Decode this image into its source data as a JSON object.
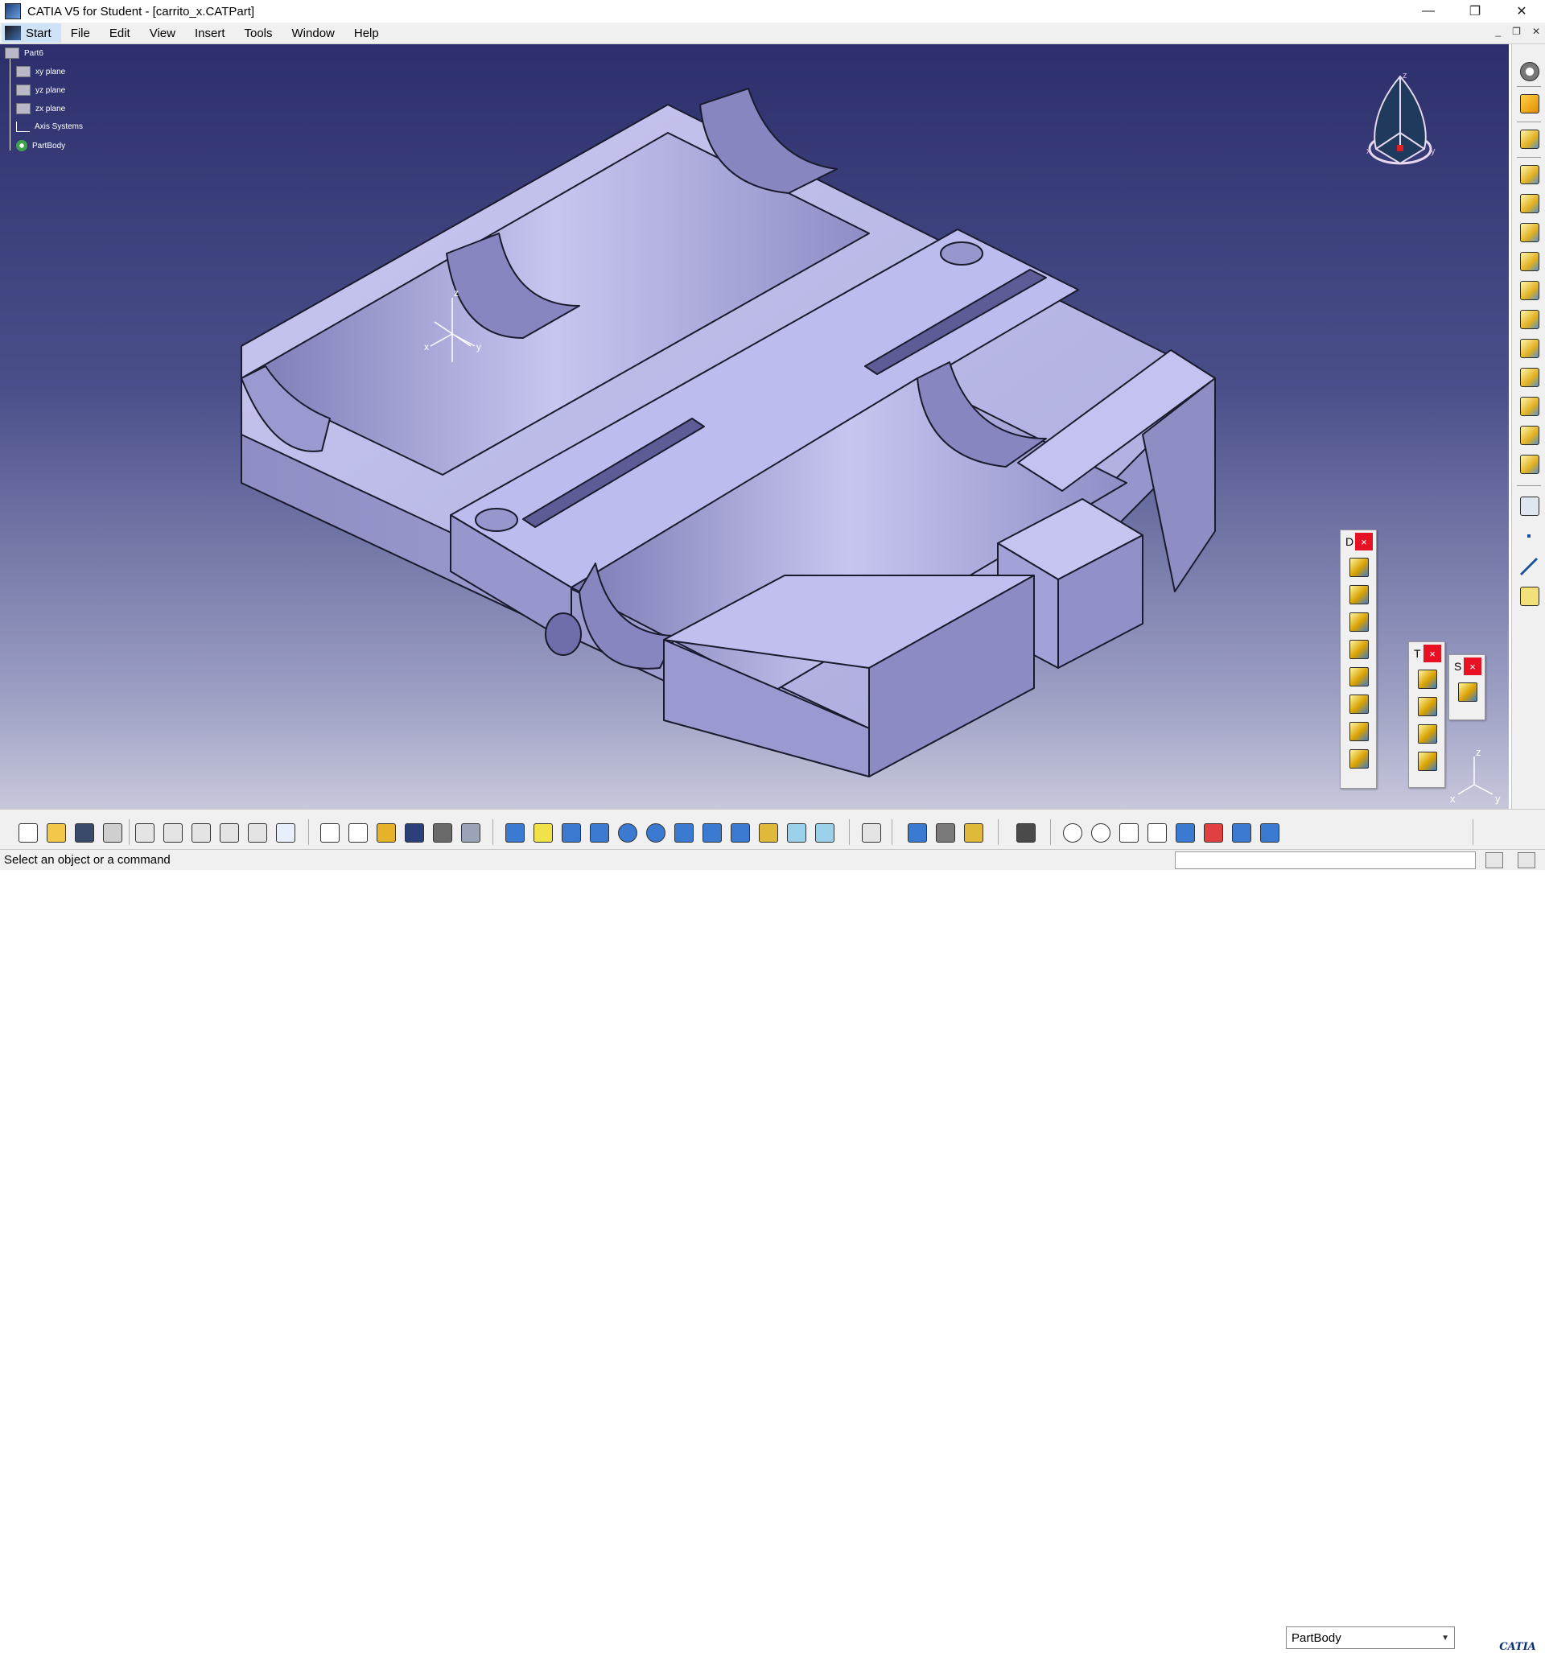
{
  "window": {
    "title": "CATIA V5 for Student - [carrito_x.CATPart]",
    "minimize_glyph": "—",
    "restore_glyph": "❐",
    "close_glyph": "✕"
  },
  "menu": {
    "start": "Start",
    "items": [
      "File",
      "Edit",
      "View",
      "Insert",
      "Tools",
      "Window",
      "Help"
    ],
    "mdi_glyphs": [
      "_",
      "❐",
      "✕"
    ]
  },
  "tree": {
    "root": "Part6",
    "children": [
      "xy plane",
      "yz plane",
      "zx plane",
      "Axis Systems",
      "PartBody"
    ]
  },
  "viewport": {
    "background_top": "#2c2f6b",
    "background_bottom": "#c7c8dc",
    "part_color": "#b7b6e6",
    "compass_labels": {
      "z": "z",
      "x": "x",
      "y": "y"
    },
    "axis_labels": {
      "x": "x",
      "y": "y",
      "z": "z"
    }
  },
  "floating_toolbars": [
    {
      "label": "D",
      "close": "×",
      "buttons": 8
    },
    {
      "label": "T",
      "close": "×",
      "buttons": 4
    },
    {
      "label": "S",
      "close": "×",
      "buttons": 1
    }
  ],
  "right_toolbar": {
    "icons": [
      "options-icon",
      "select-icon",
      "sketcher-icon",
      "pad-icon",
      "pocket-icon",
      "shaft-icon",
      "groove-icon",
      "hole-icon",
      "rib-icon",
      "slot-icon",
      "stiffener-icon",
      "multi-section-solid-icon",
      "removed-multi-section-icon",
      "extract-icon",
      "solid-combine-icon",
      "point-icon",
      "line-icon",
      "plane-icon"
    ]
  },
  "bottom_toolbar": {
    "icons": [
      "new-icon",
      "open-icon",
      "save-icon",
      "print-icon",
      "cut-icon",
      "copy-icon",
      "paste-icon",
      "undo-icon",
      "redo-icon",
      "whats-this-icon",
      "formula-icon",
      "comment-icon",
      "knowledge-icon",
      "table-icon",
      "catalog-icon",
      "measure-icon",
      "fly-icon",
      "fit-all-icon",
      "pan-icon",
      "rotate-icon",
      "zoom-in-icon",
      "zoom-out-icon",
      "normal-view-icon",
      "multi-view-icon",
      "iso-view-icon",
      "shading-icon",
      "hide-show-icon",
      "swap-visible-icon",
      "update-icon",
      "measure-between-icon",
      "measure-item-icon",
      "mass-icon",
      "capture-icon",
      "refresh-icon",
      "wireframe-icon",
      "axis-icon",
      "units-icon",
      "layer-icon",
      "graph-icon",
      "properties-icon",
      "plane-fill-icon"
    ],
    "current_body": "PartBody",
    "brand": "CATIA"
  },
  "status": {
    "message": "Select an object or a command"
  }
}
